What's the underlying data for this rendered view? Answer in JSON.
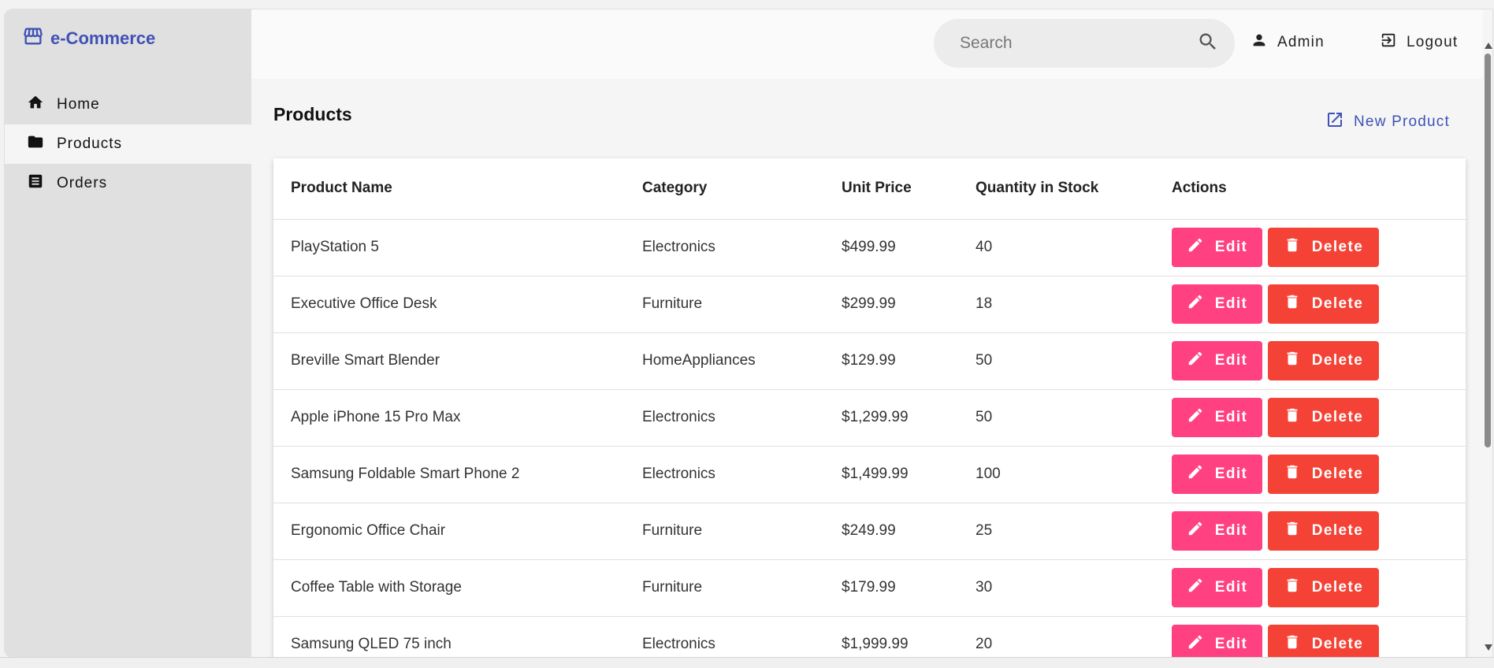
{
  "brand": {
    "name": "e-Commerce",
    "color": "#3f51b5"
  },
  "sidebar": {
    "items": [
      {
        "label": "Home",
        "icon": "home-icon",
        "active": false
      },
      {
        "label": "Products",
        "icon": "folder-icon",
        "active": true
      },
      {
        "label": "Orders",
        "icon": "list-alt-icon",
        "active": false
      }
    ]
  },
  "header": {
    "search_placeholder": "Search",
    "admin_label": "Admin",
    "logout_label": "Logout"
  },
  "main": {
    "title": "Products",
    "new_product_label": "New Product",
    "columns": [
      "Product Name",
      "Category",
      "Unit Price",
      "Quantity in Stock",
      "Actions"
    ],
    "edit_label": "Edit",
    "delete_label": "Delete",
    "rows": [
      {
        "name": "PlayStation 5",
        "category": "Electronics",
        "price": "$499.99",
        "qty": "40"
      },
      {
        "name": "Executive Office Desk",
        "category": "Furniture",
        "price": "$299.99",
        "qty": "18"
      },
      {
        "name": "Breville Smart Blender",
        "category": "HomeAppliances",
        "price": "$129.99",
        "qty": "50"
      },
      {
        "name": "Apple iPhone 15 Pro Max",
        "category": "Electronics",
        "price": "$1,299.99",
        "qty": "50"
      },
      {
        "name": "Samsung Foldable Smart Phone 2",
        "category": "Electronics",
        "price": "$1,499.99",
        "qty": "100"
      },
      {
        "name": "Ergonomic Office Chair",
        "category": "Furniture",
        "price": "$249.99",
        "qty": "25"
      },
      {
        "name": "Coffee Table with Storage",
        "category": "Furniture",
        "price": "$179.99",
        "qty": "30"
      },
      {
        "name": "Samsung QLED 75 inch",
        "category": "Electronics",
        "price": "$1,999.99",
        "qty": "20"
      }
    ]
  },
  "colors": {
    "edit": "#ff4081",
    "delete": "#f44336",
    "accent": "#3f51b5"
  }
}
